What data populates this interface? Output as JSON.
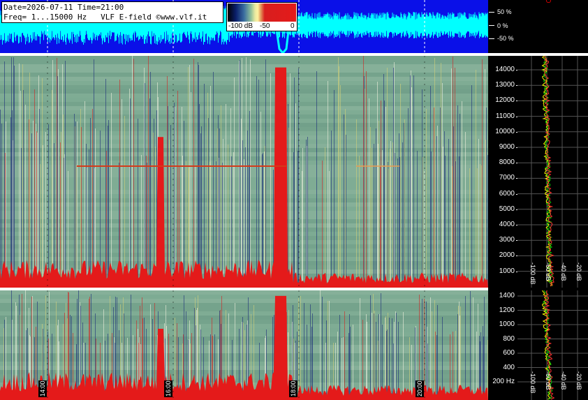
{
  "info": {
    "line1": "Date=2026-07-11 Time=21:00",
    "line2": "Freq= 1...15000 Hz   VLF E-field ©www.vlf.it"
  },
  "colorbar": {
    "labels": [
      "-100 dB",
      "-50",
      "0"
    ]
  },
  "waveform": {
    "percent_labels": [
      "50 %",
      "0 %",
      "-50 %"
    ]
  },
  "main_axis": {
    "freq_labels": [
      "14000",
      "13000",
      "12000",
      "11000",
      "10000",
      "9000",
      "8000",
      "7000",
      "6000",
      "5000",
      "4000",
      "3000",
      "2000",
      "1000"
    ]
  },
  "low_axis": {
    "freq_labels": [
      "1400",
      "1200",
      "1000",
      "800",
      "600",
      "400",
      "200 Hz"
    ]
  },
  "db_labels": [
    "-100 dB",
    "-60 dB",
    "-40 dB",
    "-20 dB"
  ],
  "time_labels": [
    "14:00",
    "16:00",
    "18:00",
    "20:00"
  ],
  "colors": {
    "wave_bg": "#0a10e8",
    "wave_trace": "#00ffff",
    "spectrum_bg": "#6f9f8a",
    "strong": "#e41a1a"
  }
}
